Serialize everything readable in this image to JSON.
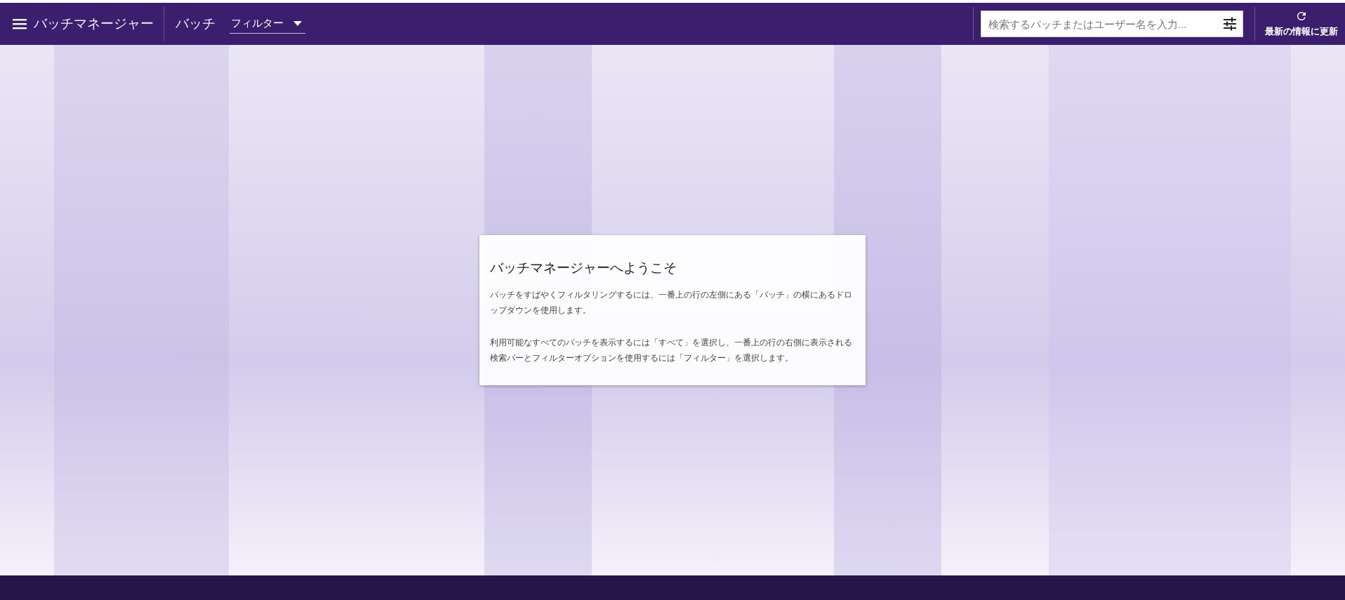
{
  "app_bar": {
    "title": "バッチマネージャー",
    "section": "バッチ",
    "filter_dropdown": {
      "value": "フィルター"
    },
    "search": {
      "placeholder": "検索するバッチまたはユーザー名を入力..."
    },
    "refresh_button": {
      "label": "最新の情報に更新"
    }
  },
  "welcome_card": {
    "title": "バッチマネージャーへようこそ",
    "paragraphs": [
      "バッチをすばやくフィルタリングするには、一番上の行の左側にある「バッチ」の横にあるドロップダウンを使用します。",
      "利用可能なすべてのバッチを表示するには「すべて」を選択し、一番上の行の右側に表示される検索バーとフィルターオプションを使用するには「フィルター」を選択します。"
    ]
  }
}
